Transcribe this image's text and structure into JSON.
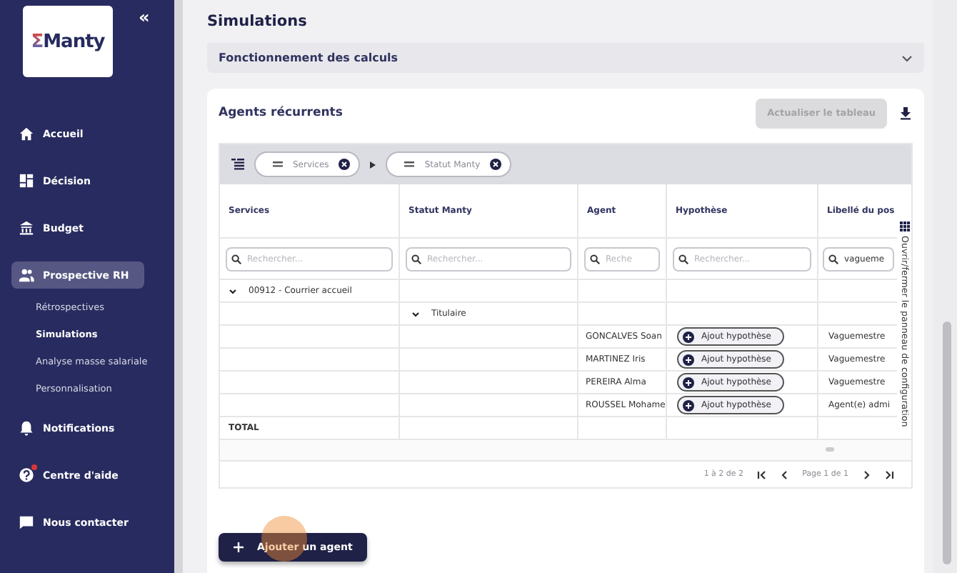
{
  "sidebar": {
    "logo": {
      "mark": "Σ",
      "name": "Manty"
    },
    "collapse_glyph": "«",
    "items": [
      {
        "label": "Accueil",
        "selected": false,
        "alert": false
      },
      {
        "label": "Décision",
        "selected": false,
        "alert": false
      },
      {
        "label": "Budget",
        "selected": false,
        "alert": false
      },
      {
        "label": "Prospective RH",
        "selected": true,
        "alert": false,
        "children": [
          {
            "label": "Rétrospectives",
            "selected": false
          },
          {
            "label": "Simulations",
            "selected": true
          },
          {
            "label": "Analyse masse salariale",
            "selected": false
          },
          {
            "label": "Personnalisation",
            "selected": false
          }
        ]
      },
      {
        "label": "Notifications",
        "selected": false,
        "alert": false
      },
      {
        "label": "Centre d'aide",
        "selected": false,
        "alert": true
      },
      {
        "label": "Nous contacter",
        "selected": false,
        "alert": false
      }
    ]
  },
  "page": {
    "title": "Simulations",
    "accordion": {
      "title": "Fonctionnement des calculs",
      "expanded": false
    },
    "card": {
      "title": "Agents récurrents",
      "refresh_button": {
        "label": "Actualiser le tableau",
        "disabled": true
      },
      "table": {
        "group_chips": [
          "Services",
          "Statut Manty"
        ],
        "columns": [
          "Services",
          "Statut Manty",
          "Agent",
          "Hypothèse",
          "Libellé du pos"
        ],
        "filters": [
          {
            "placeholder": "Rechercher..."
          },
          {
            "placeholder": "Rechercher..."
          },
          {
            "placeholder": "Reche"
          },
          {
            "placeholder": "Rechercher..."
          },
          {
            "value": "vagueme"
          }
        ],
        "rows": [
          {
            "kind": "group",
            "label": "00912 - Courrier accueil",
            "expanded": true
          },
          {
            "kind": "subgroup",
            "label": "Titulaire",
            "expanded": true
          },
          {
            "kind": "agent",
            "agent": "GONCALVES Soan",
            "action": "Ajout hypothèse",
            "poste": "Vaguemestre"
          },
          {
            "kind": "agent",
            "agent": "MARTINEZ Iris",
            "action": "Ajout hypothèse",
            "poste": "Vaguemestre"
          },
          {
            "kind": "agent",
            "agent": "PEREIRA Alma",
            "action": "Ajout hypothèse",
            "poste": "Vaguemestre"
          },
          {
            "kind": "agent",
            "agent": "ROUSSEL Mohame",
            "action": "Ajout hypothèse",
            "poste": "Agent(e) admi"
          },
          {
            "kind": "total",
            "label": "TOTAL"
          }
        ],
        "side_panel_toggle": "Ouvrir/fermer le panneau de configuration",
        "pagination": {
          "range": "1 à 2 de 2",
          "page": "Page 1 de 1"
        }
      },
      "add_button": "Ajouter un agent"
    }
  }
}
